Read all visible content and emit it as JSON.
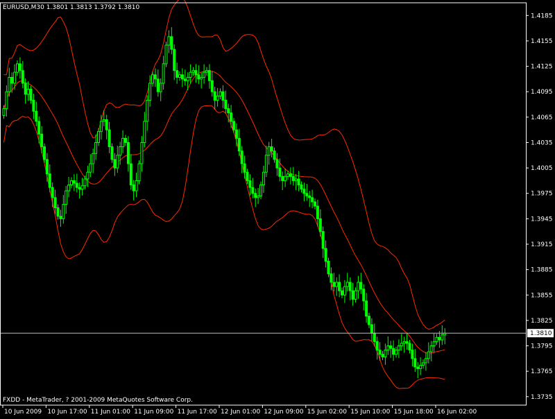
{
  "header": {
    "symbol_info": "EURUSD,M30  1.3801 1.3813 1.3792 1.3810"
  },
  "footer": {
    "copyright": "FXDD - MetaTrader, ? 2001-2009 MetaQuotes Software Corp."
  },
  "colors": {
    "background": "#000000",
    "frame": "#ffffff",
    "candle": "#00ff00",
    "bands": "#ff2a00",
    "bid_line": "#c0c0c0",
    "text": "#ffffff",
    "price_label_text": "#000000",
    "price_label_bg": "#ffffff"
  },
  "chart_data": {
    "type": "candlestick",
    "symbol": "EURUSD",
    "timeframe": "M30",
    "last_ohlc": {
      "open": 1.3801,
      "high": 1.3813,
      "low": 1.3792,
      "close": 1.381
    },
    "current_price": 1.381,
    "ylim": [
      1.3725,
      1.42
    ],
    "y_ticks": [
      1.4185,
      1.4155,
      1.4125,
      1.4095,
      1.4065,
      1.4035,
      1.4005,
      1.3975,
      1.3945,
      1.3915,
      1.3885,
      1.3855,
      1.3825,
      1.3795,
      1.3765,
      1.3735
    ],
    "x_ticks": [
      "10 Jun 2009",
      "10 Jun 17:00",
      "11 Jun 01:00",
      "11 Jun 09:00",
      "11 Jun 17:00",
      "12 Jun 01:00",
      "12 Jun 09:00",
      "15 Jun 02:00",
      "15 Jun 10:00",
      "15 Jun 18:00",
      "16 Jun 02:00"
    ],
    "x_tick_index": [
      0,
      16,
      32,
      48,
      64,
      80,
      96,
      112,
      128,
      144,
      160
    ],
    "bar_count": 187,
    "close_series": [
      1.4075,
      1.4095,
      1.4112,
      1.4105,
      1.4118,
      1.4128,
      1.412,
      1.4105,
      1.4092,
      1.4098,
      1.4085,
      1.4072,
      1.406,
      1.4045,
      1.403,
      1.4015,
      1.3998,
      1.3982,
      1.397,
      1.3958,
      1.3948,
      1.3945,
      1.3962,
      1.3978,
      1.3985,
      1.399,
      1.3987,
      1.3982,
      1.398,
      1.3984,
      1.3992,
      1.4,
      1.401,
      1.4022,
      1.4035,
      1.4048,
      1.406,
      1.4062,
      1.405,
      1.403,
      1.4015,
      1.4005,
      1.402,
      1.403,
      1.404,
      1.4035,
      1.401,
      1.3985,
      1.3978,
      1.399,
      1.401,
      1.4035,
      1.406,
      1.4085,
      1.4105,
      1.4115,
      1.411,
      1.4095,
      1.4105,
      1.4128,
      1.415,
      1.416,
      1.4145,
      1.412,
      1.4112,
      1.4115,
      1.411,
      1.4108,
      1.4112,
      1.4118,
      1.412,
      1.4115,
      1.411,
      1.4112,
      1.4118,
      1.412,
      1.4108,
      1.4095,
      1.4085,
      1.409,
      1.4095,
      1.4085,
      1.4075,
      1.407,
      1.406,
      1.405,
      1.404,
      1.4025,
      1.401,
      1.4,
      1.399,
      1.3982,
      1.3975,
      1.397,
      1.3972,
      1.3985,
      1.4,
      1.402,
      1.403,
      1.4025,
      1.4015,
      1.4005,
      1.3995,
      1.399,
      1.3995,
      1.3998,
      1.3995,
      1.399,
      1.3992,
      1.3985,
      1.398,
      1.3975,
      1.3972,
      1.397,
      1.3965,
      1.396,
      1.3945,
      1.393,
      1.391,
      1.3895,
      1.388,
      1.387,
      1.3865,
      1.387,
      1.386,
      1.3855,
      1.3865,
      1.387,
      1.386,
      1.385,
      1.386,
      1.387,
      1.3862,
      1.3848,
      1.383,
      1.382,
      1.381,
      1.38,
      1.379,
      1.3785,
      1.3782,
      1.379,
      1.3795,
      1.3792,
      1.3785,
      1.379,
      1.3795,
      1.3798,
      1.38,
      1.3798,
      1.379,
      1.378,
      1.377,
      1.3768,
      1.3772,
      1.3775,
      1.378,
      1.3788,
      1.3795,
      1.38,
      1.3805,
      1.3802,
      1.3808,
      1.381
    ],
    "indicator": "Bollinger Bands"
  }
}
